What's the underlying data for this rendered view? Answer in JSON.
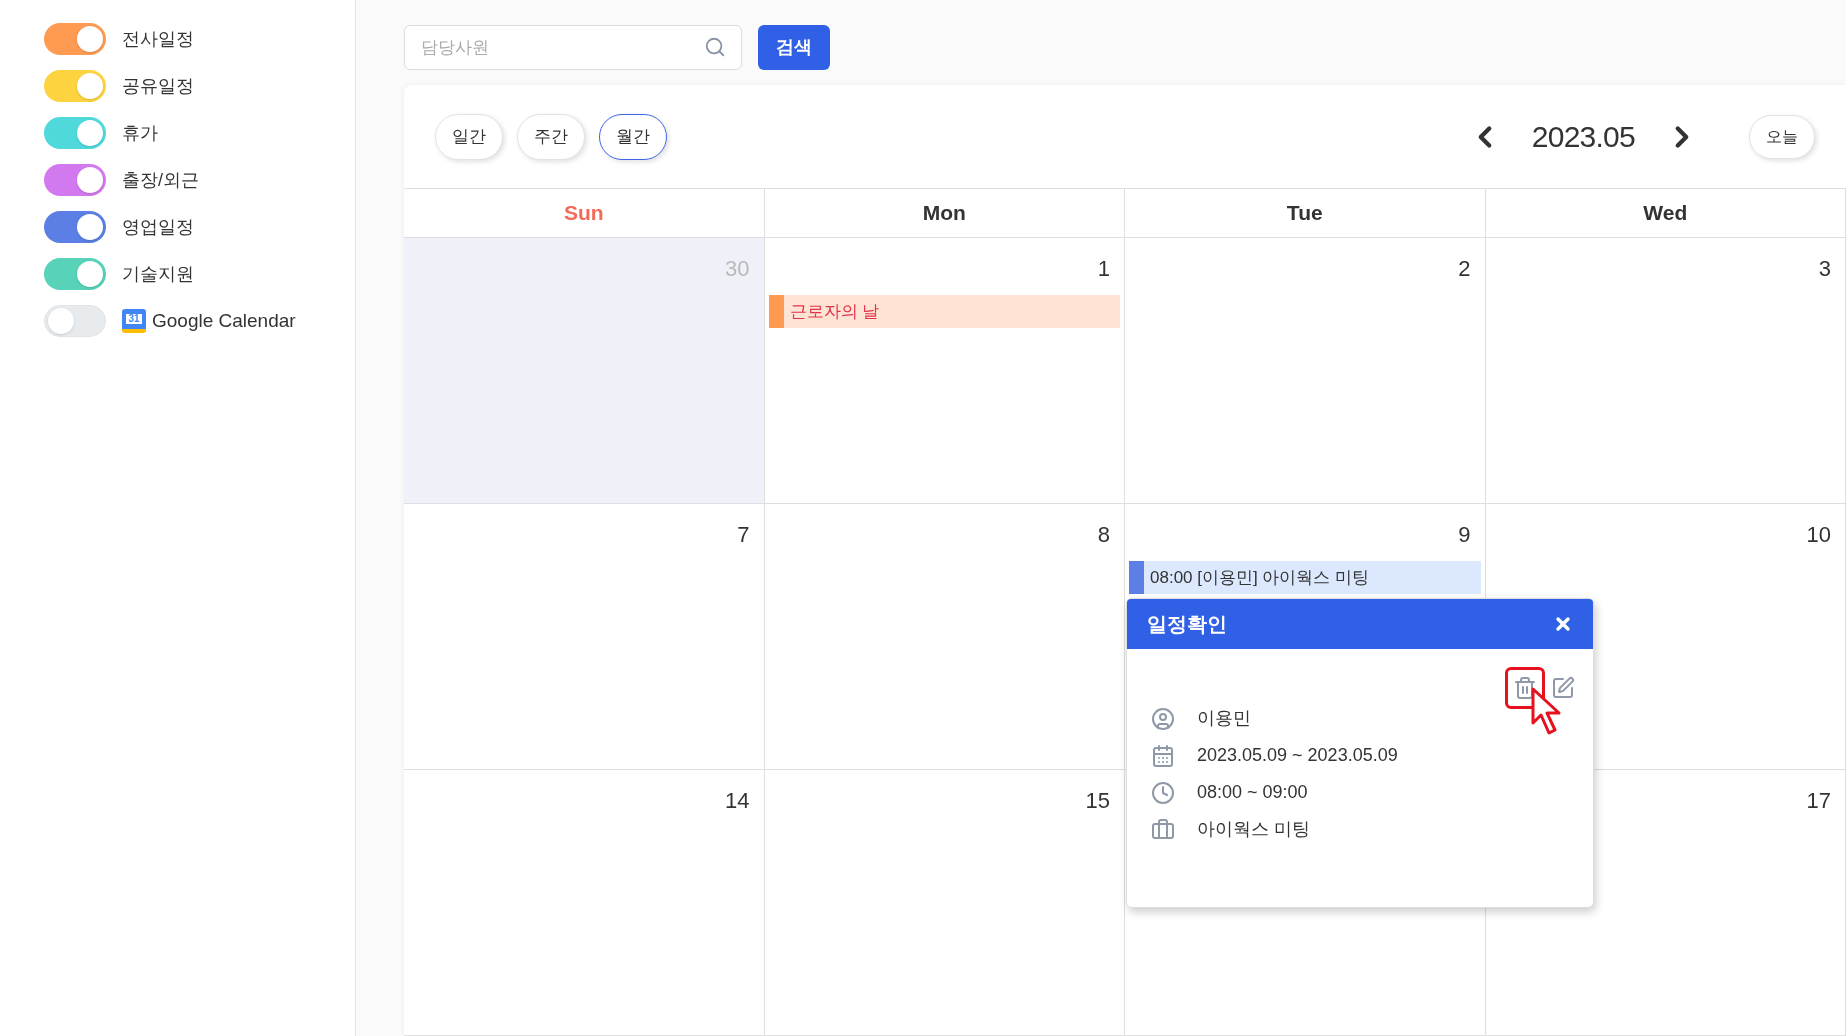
{
  "sidebar": {
    "calendars": [
      {
        "label": "전사일정",
        "on": true,
        "color": "#ff9a52",
        "kind": "plain"
      },
      {
        "label": "공유일정",
        "on": true,
        "color": "#fdd33f",
        "kind": "plain"
      },
      {
        "label": "휴가",
        "on": true,
        "color": "#4fd9da",
        "kind": "plain"
      },
      {
        "label": "출장/외근",
        "on": true,
        "color": "#d379ef",
        "kind": "plain"
      },
      {
        "label": "영업일정",
        "on": true,
        "color": "#5b7fe4",
        "kind": "plain"
      },
      {
        "label": "기술지원",
        "on": true,
        "color": "#58d2b8",
        "kind": "plain"
      },
      {
        "label": "Google Calendar",
        "on": false,
        "color": "#e8ebee",
        "kind": "google",
        "icon_text": "31"
      }
    ]
  },
  "search": {
    "placeholder": "담당사원",
    "button": "검색"
  },
  "toolbar": {
    "views": [
      {
        "label": "일간",
        "selected": false
      },
      {
        "label": "주간",
        "selected": false
      },
      {
        "label": "월간",
        "selected": true
      }
    ],
    "month": "2023.05",
    "today": "오늘"
  },
  "calendar": {
    "weekdays": [
      {
        "label": "Sun",
        "kind": "sunday"
      },
      {
        "label": "Mon",
        "kind": "weekday"
      },
      {
        "label": "Tue",
        "kind": "weekday"
      },
      {
        "label": "Wed",
        "kind": "weekday"
      }
    ],
    "weeks": [
      [
        {
          "day": "30",
          "muted": true
        },
        {
          "day": "1",
          "muted": false,
          "events": [
            {
              "kind": "holiday",
              "text": "근로자의 날"
            }
          ]
        },
        {
          "day": "2",
          "muted": false
        },
        {
          "day": "3",
          "muted": false
        }
      ],
      [
        {
          "day": "7",
          "muted": false
        },
        {
          "day": "8",
          "muted": false
        },
        {
          "day": "9",
          "muted": false,
          "events": [
            {
              "kind": "schedule",
              "text": "08:00 [이용민] 아이웍스 미팅"
            }
          ]
        },
        {
          "day": "10",
          "muted": false
        }
      ],
      [
        {
          "day": "14",
          "muted": false
        },
        {
          "day": "15",
          "muted": false
        },
        {
          "muted": false
        },
        {
          "day": "17",
          "muted": false
        }
      ]
    ]
  },
  "popup": {
    "title": "일정확인",
    "details": [
      {
        "kind": "person",
        "text": "이용민"
      },
      {
        "kind": "date",
        "text": "2023.05.09 ~ 2023.05.09"
      },
      {
        "kind": "time",
        "text": "08:00 ~ 09:00"
      },
      {
        "kind": "work",
        "text": "아이웍스 미팅"
      }
    ]
  }
}
